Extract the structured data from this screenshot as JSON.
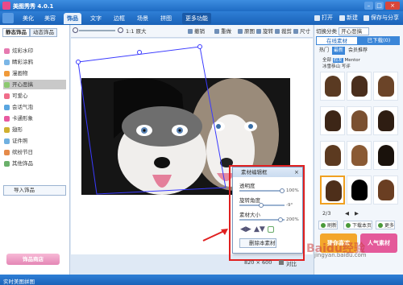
{
  "app": {
    "title": "美图秀秀 4.0.1"
  },
  "menu": {
    "tabs": [
      "美化",
      "美容",
      "饰品",
      "文字",
      "边框",
      "场景",
      "拼图",
      "更多功能"
    ],
    "active": "饰品",
    "right": [
      "打开",
      "新建",
      "保存与分享"
    ]
  },
  "left_panel": {
    "tabs": [
      "静态饰品",
      "动态饰品"
    ],
    "items": [
      "炫彩水印",
      "睛彩涂鸦",
      "漫画物",
      "开心恶搞",
      "可爱心",
      "会话气泡",
      "卡通形象",
      "翅形",
      "证件照",
      "缤纷节日",
      "其他饰品"
    ],
    "selected": "开心恶搞",
    "import": "导入饰品",
    "shop": "饰品商店"
  },
  "toolbar": {
    "zoom_label": "1:1 原大",
    "items": [
      "撤销",
      "重做",
      "原图",
      "旋转",
      "裁剪",
      "尺寸"
    ]
  },
  "dialog": {
    "title": "素材编辑框",
    "opacity_label": "透明度",
    "opacity_value": "100%",
    "opacity": 1.0,
    "rotate_label": "旋转角度",
    "rotate_value": "-9°",
    "rotate": 0.48,
    "size_label": "素材大小",
    "size_value": "200%",
    "size": 0.95,
    "delete": "删除本素材"
  },
  "canvas": {
    "dimensions": "820 × 600",
    "zoom_text": "对比"
  },
  "right_panel": {
    "header": "切换分类",
    "category": "开心恶搞",
    "tabs": [
      "在线素材",
      "已下载(0)"
    ],
    "subtabs": [
      "热门",
      "最新",
      "会员推荐"
    ],
    "tags": [
      "全部",
      "假发",
      "Mentor",
      "冰雪恭山",
      "写评"
    ],
    "tags_active": "假发",
    "page": "2/3",
    "btn_refresh": "刷新",
    "btn_download": "下载本页",
    "btn_more": "更多",
    "ad1": "猜你喜欢",
    "ad2": "人气素材"
  },
  "status": {
    "left": "实时美图拼图"
  },
  "watermark": {
    "text": "Baidu经验",
    "url": "jingyan.baidu.com"
  },
  "colors": {
    "titlebar": "#1f6cc4",
    "accent": "#3b86d8",
    "highlight_box": "#e02020"
  }
}
